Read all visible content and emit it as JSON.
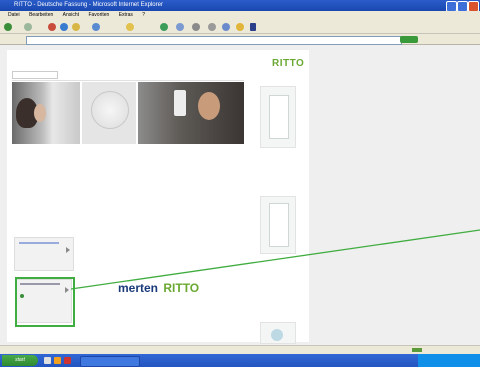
{
  "window": {
    "title": "RITTO - Deutsche Fassung - Microsoft Internet Explorer"
  },
  "menubar": {
    "items": [
      "Datei",
      "Bearbeiten",
      "Ansicht",
      "Favoriten",
      "Extras",
      "?"
    ]
  },
  "addressbar": {
    "label": "",
    "url": ""
  },
  "site": {
    "brand": "RITTO",
    "top_nav": [
      "",
      "",
      "",
      ""
    ],
    "cat_nav": [
      "",
      "",
      "",
      "",
      ""
    ],
    "main_heading": "",
    "subheading": "",
    "subheading2": "",
    "logo_word1": "merten",
    "logo_word2": "RITTO"
  },
  "taskbar": {
    "start_label": "start"
  },
  "colors": {
    "callout": "#40ad40",
    "brand_green": "#6aa832",
    "titlebar": "#2a5cc9"
  }
}
